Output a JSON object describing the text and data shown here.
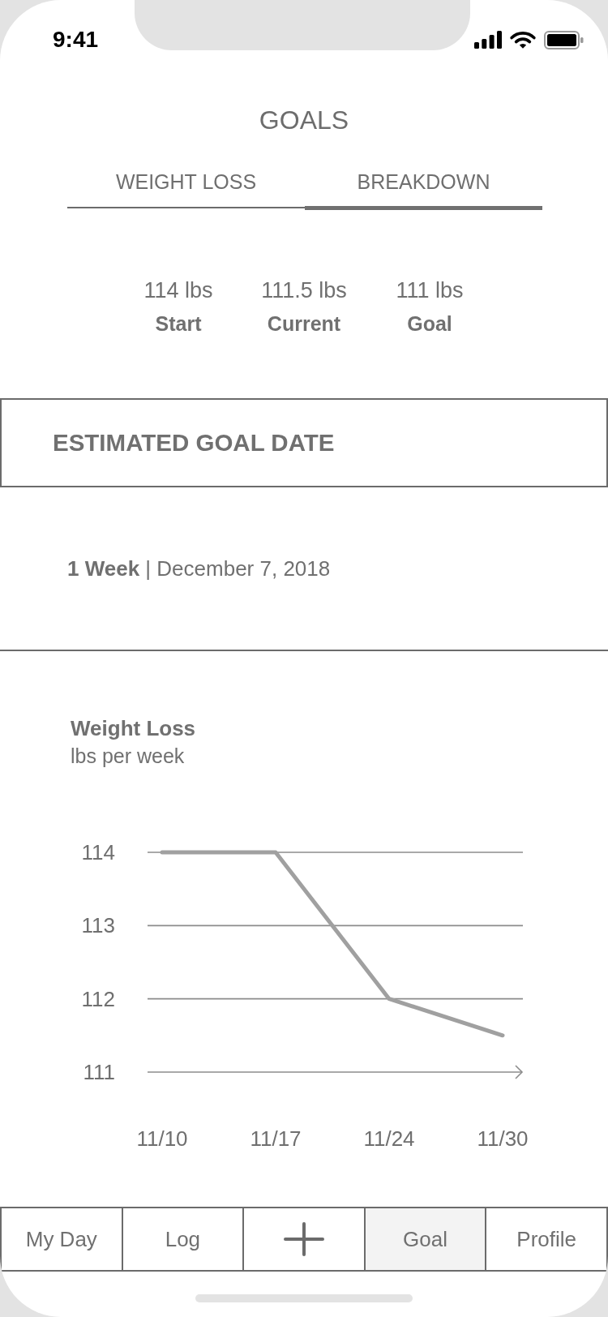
{
  "status_bar": {
    "time": "9:41"
  },
  "title": "GOALS",
  "tabs": [
    {
      "label": "WEIGHT LOSS",
      "selected": false
    },
    {
      "label": "BREAKDOWN",
      "selected": true
    }
  ],
  "stats": [
    {
      "value": "114 lbs",
      "label": "Start"
    },
    {
      "value": "111.5 lbs",
      "label": "Current"
    },
    {
      "value": "111 lbs",
      "label": "Goal"
    }
  ],
  "estimate": {
    "heading": "ESTIMATED GOAL DATE",
    "text": "**1 Week** | December 7, 2018"
  },
  "chart": {
    "chart_data": {
      "type": "line",
      "title": "Weight Loss",
      "ylabel": "lbs per week",
      "categories": [
        "11/10",
        "11/17",
        "11/24",
        "11/30"
      ],
      "series": [
        {
          "color": "#a0a0a0",
          "values": [
            114,
            114,
            112,
            111.5
          ]
        }
      ],
      "ylim": [
        111,
        114
      ],
      "yticks": [
        111,
        112,
        113,
        114
      ]
    }
  },
  "nav": {
    "items": [
      {
        "kind": "text",
        "label": "My Day",
        "selected": false
      },
      {
        "kind": "text",
        "label": "Log",
        "selected": false
      },
      {
        "kind": "icon",
        "selected": false
      },
      {
        "kind": "text",
        "label": "Goal",
        "selected": true
      },
      {
        "kind": "text",
        "label": "Profile",
        "selected": false
      }
    ]
  }
}
